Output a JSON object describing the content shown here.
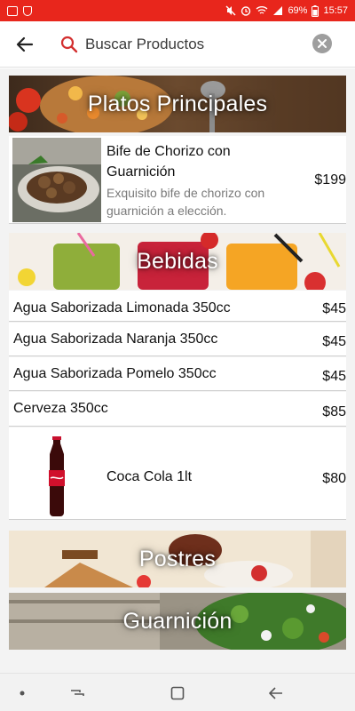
{
  "status_bar": {
    "battery": "69%",
    "time": "15:57",
    "icons": [
      "image-icon",
      "hand-icon",
      "mute-icon",
      "alarm-icon",
      "wifi-icon",
      "signal-icon",
      "battery-icon"
    ]
  },
  "search": {
    "placeholder": "Buscar Productos",
    "value": "",
    "icons": {
      "back": "arrow-left-icon",
      "search": "search-icon",
      "clear": "clear-icon"
    }
  },
  "colors": {
    "status_bar": "#e8261c",
    "search_icon": "#d32f2f",
    "banner_text": "#ffffff"
  },
  "sections": [
    {
      "title": "Platos Principales",
      "items": [
        {
          "name_line1": "Bife de Chorizo con",
          "name_line2": "Guarnición",
          "desc_line1": "Exquisito bife de chorizo con",
          "desc_line2": "guarnición a elección.",
          "price": "$199"
        }
      ]
    },
    {
      "title": "Bebidas",
      "items": [
        {
          "name": "Agua Saborizada Limonada 350cc",
          "price": "$45"
        },
        {
          "name": "Agua Saborizada Naranja 350cc",
          "price": "$45"
        },
        {
          "name": "Agua Saborizada Pomelo 350cc",
          "price": "$45"
        },
        {
          "name": "Cerveza 350cc",
          "price": "$85"
        },
        {
          "name": "Coca Cola 1lt",
          "price": "$80"
        }
      ]
    },
    {
      "title": "Postres",
      "items": []
    },
    {
      "title": "Guarnición",
      "items": []
    }
  ],
  "navigation": {
    "icons": [
      "dot-icon",
      "recent-apps-icon",
      "home-icon",
      "back-icon"
    ]
  }
}
